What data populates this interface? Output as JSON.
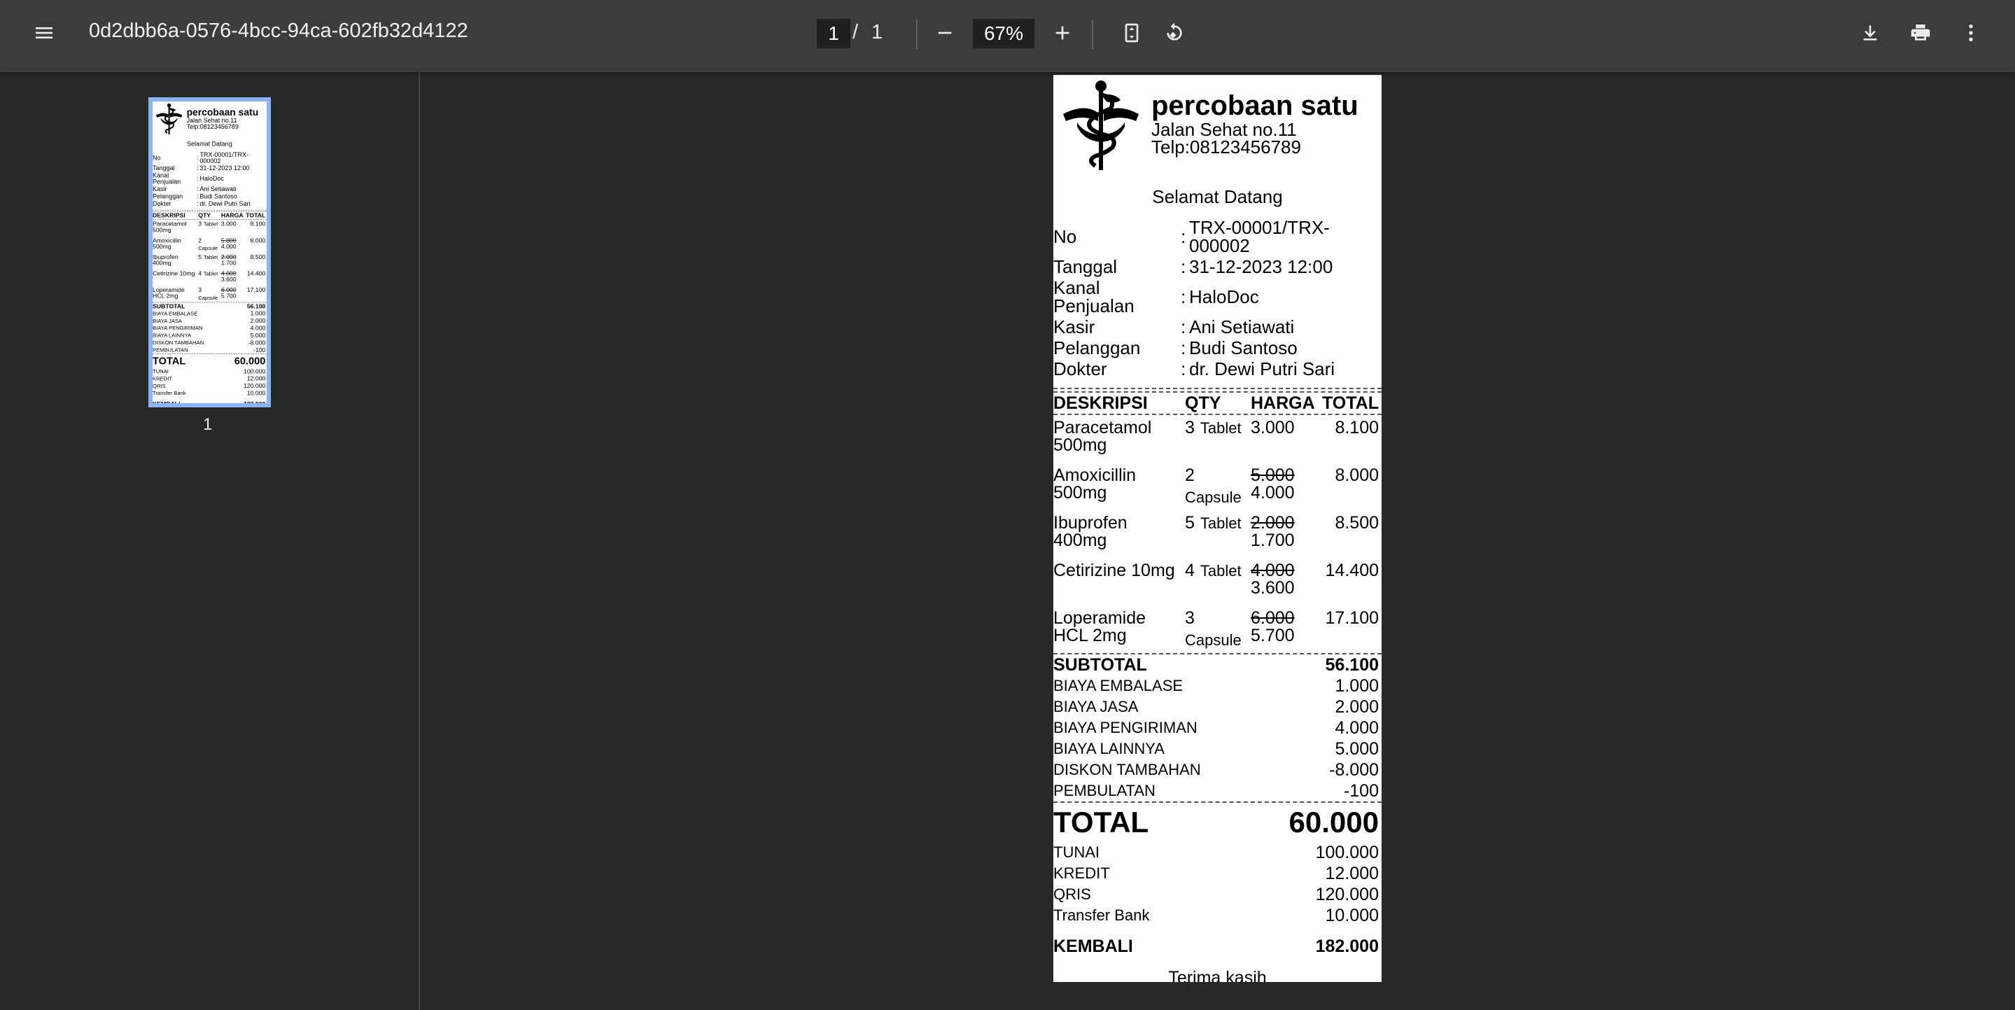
{
  "toolbar": {
    "doc_title": "0d2dbb6a-0576-4bcc-94ca-602fb32d4122",
    "page_current": "1",
    "page_sep": "/",
    "page_total": "1",
    "zoom": "67%",
    "icons": [
      "menu-icon",
      "zoom-out-icon",
      "zoom-in-icon",
      "fit-page-icon",
      "rotate-icon",
      "download-icon",
      "print-icon",
      "more-vert-icon"
    ]
  },
  "sidebar": {
    "thumb_label": "1"
  },
  "receipt": {
    "store_name": "percobaan satu",
    "address": "Jalan Sehat no.11",
    "phone": "Telp:08123456789",
    "welcome": "Selamat Datang",
    "info": [
      {
        "key": "No",
        "value": "TRX-00001/TRX-000002"
      },
      {
        "key": "Tanggal",
        "value": "31-12-2023 12:00"
      },
      {
        "key": "Kanal Penjualan",
        "value": "HaloDoc"
      },
      {
        "key": "Kasir",
        "value": "Ani Setiawati"
      },
      {
        "key": "Pelanggan",
        "value": "Budi Santoso"
      },
      {
        "key": "Dokter",
        "value": "dr. Dewi Putri Sari"
      }
    ],
    "columns": {
      "desc": "DESKRIPSI",
      "qty": "QTY",
      "price": "HARGA",
      "total": "TOTAL"
    },
    "items": [
      {
        "name": "Paracetamol 500mg",
        "qty": "3",
        "unit": "Tablet",
        "orig_price": "",
        "price": "3.000",
        "total": "8.100"
      },
      {
        "name": "Amoxicillin 500mg",
        "qty": "2",
        "unit": "Capsule",
        "orig_price": "5.000",
        "price": "4.000",
        "total": "8.000"
      },
      {
        "name": "Ibuprofen 400mg",
        "qty": "5",
        "unit": "Tablet",
        "orig_price": "2.000",
        "price": "1.700",
        "total": "8.500"
      },
      {
        "name": "Cetirizine 10mg",
        "qty": "4",
        "unit": "Tablet",
        "orig_price": "4.000",
        "price": "3.600",
        "total": "14.400"
      },
      {
        "name": "Loperamide HCL 2mg",
        "qty": "3",
        "unit": "Capsule",
        "orig_price": "6.000",
        "price": "5.700",
        "total": "17.100"
      }
    ],
    "subtotal": {
      "label": "SUBTOTAL",
      "value": "56.100"
    },
    "charges": [
      {
        "label": "BIAYA EMBALASE",
        "value": "1.000"
      },
      {
        "label": "BIAYA JASA",
        "value": "2.000"
      },
      {
        "label": "BIAYA PENGIRIMAN",
        "value": "4.000"
      },
      {
        "label": "BIAYA LAINNYA",
        "value": "5.000"
      },
      {
        "label": "DISKON TAMBAHAN",
        "value": "-8.000"
      },
      {
        "label": "PEMBULATAN",
        "value": "-100"
      }
    ],
    "total": {
      "label": "TOTAL",
      "value": "60.000"
    },
    "payments": [
      {
        "label": "TUNAI",
        "value": "100.000"
      },
      {
        "label": "KREDIT",
        "value": "12.000"
      },
      {
        "label": "QRIS",
        "value": "120.000"
      },
      {
        "label": "Transfer Bank",
        "value": "10.000"
      }
    ],
    "change": {
      "label": "KEMBALI",
      "value": "182.000"
    },
    "thanks": "Terima kasih"
  },
  "colors": {
    "toolbar_bg": "#3c3c3c",
    "viewer_bg": "#282828",
    "thumb_border": "#8ab4f8"
  }
}
